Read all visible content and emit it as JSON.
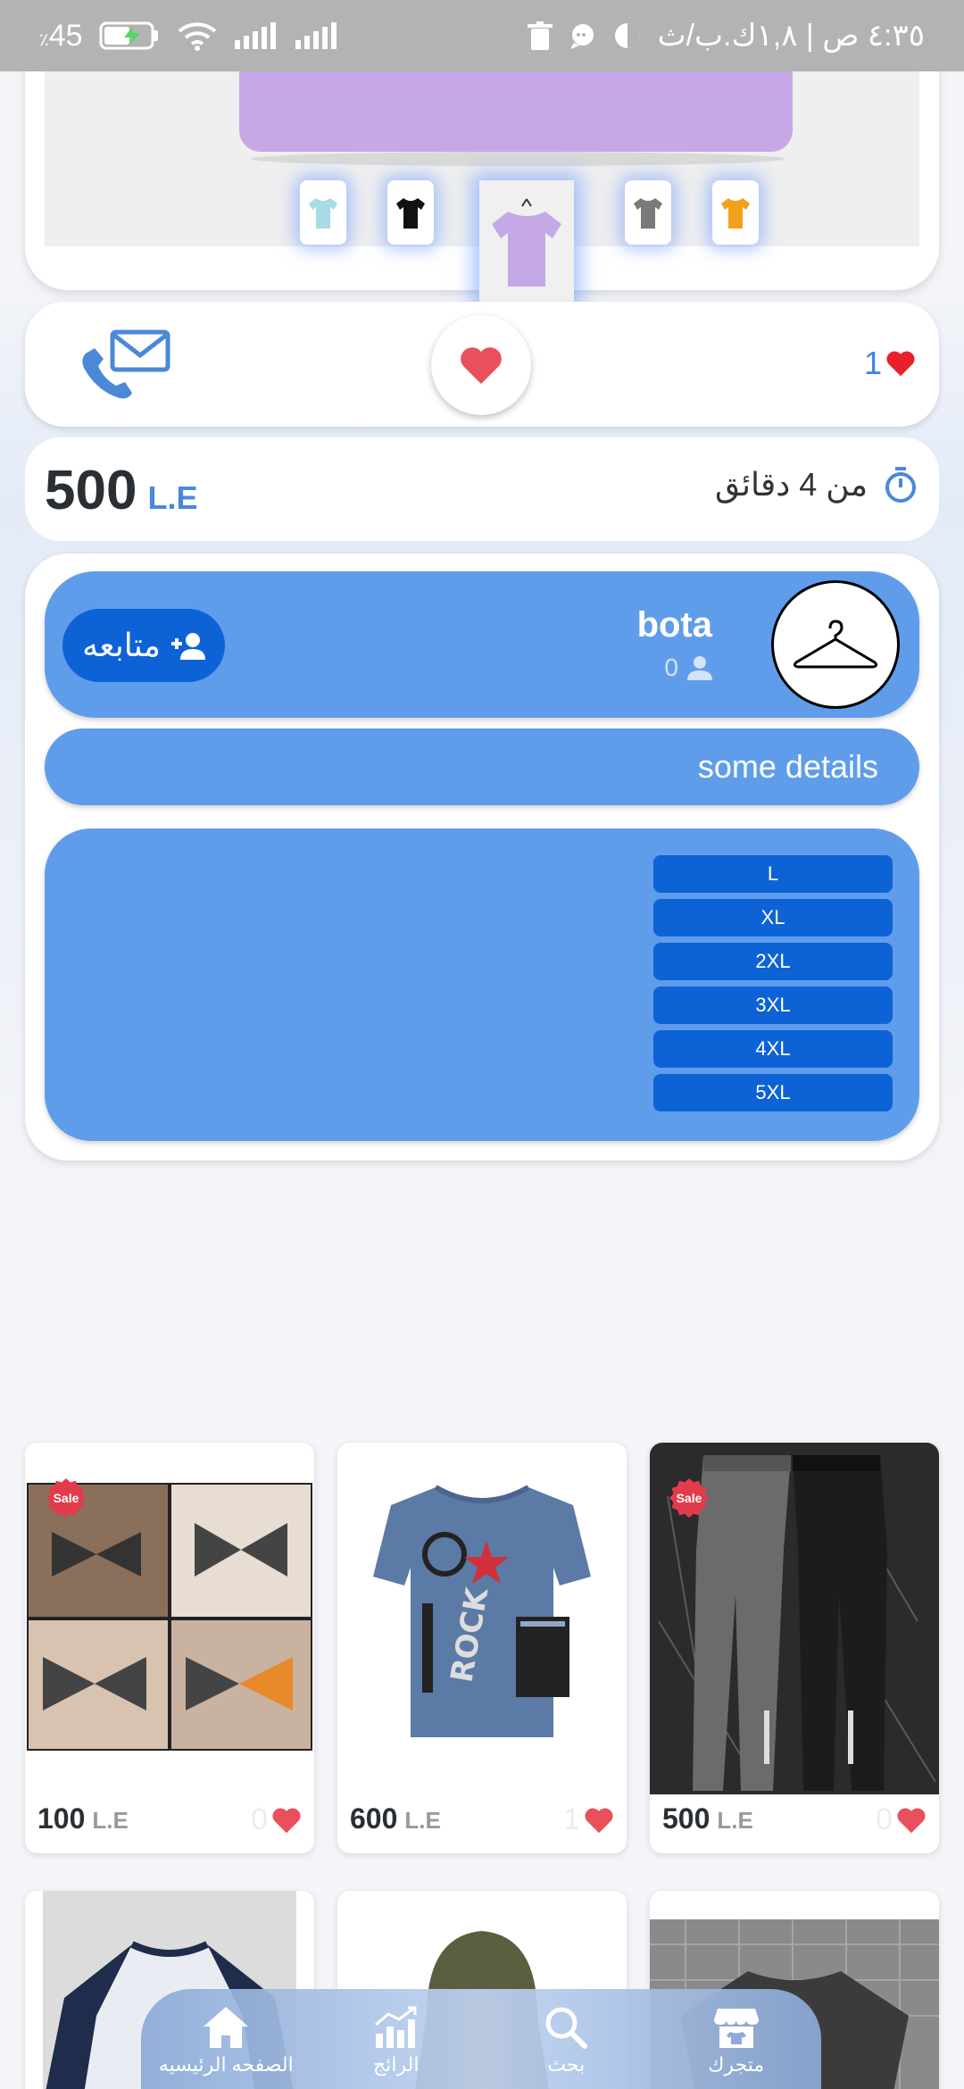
{
  "status_bar": {
    "battery": "45",
    "time": "٤:٣٥ ص | ١,٨ك.ب/ث"
  },
  "actions": {
    "like_count": "1"
  },
  "price": {
    "amount": "500",
    "currency": "L.E"
  },
  "posted": {
    "text": "من 4 دقائق"
  },
  "seller": {
    "name": "bota",
    "followers": "0",
    "follow_label": "متابعه"
  },
  "details": "some details",
  "sizes": [
    "L",
    "XL",
    "2XL",
    "3XL",
    "4XL",
    "5XL"
  ],
  "products": [
    {
      "price": "100",
      "currency": "L.E",
      "likes": "0",
      "sale": "Sale"
    },
    {
      "price": "600",
      "currency": "L.E",
      "likes": "1"
    },
    {
      "price": "500",
      "currency": "L.E",
      "likes": "0",
      "sale": "Sale"
    }
  ],
  "nav": {
    "home": "الصفحه الرئيسيه",
    "trending": "الرائج",
    "search": "بحث",
    "store": "متجرك"
  },
  "colors": {
    "accent": "#5f9deb",
    "button": "#0d63d6",
    "heart": "#e8505b",
    "currency": "#4a88d8"
  }
}
